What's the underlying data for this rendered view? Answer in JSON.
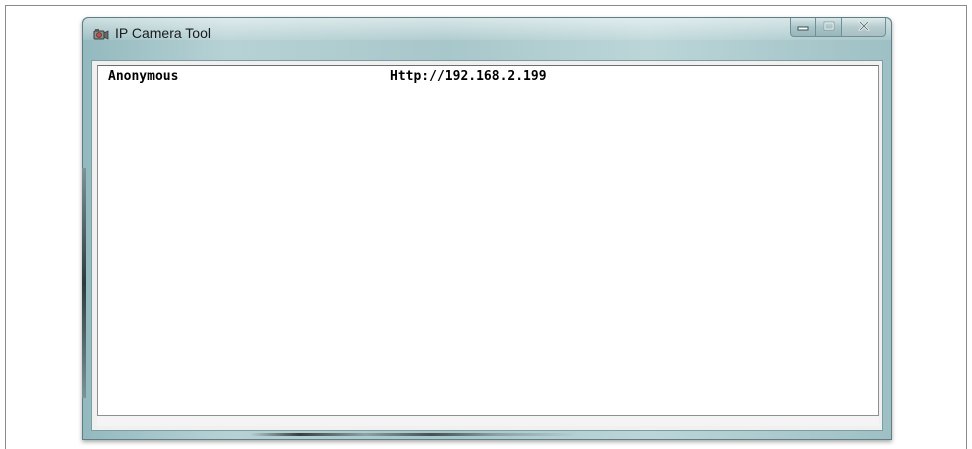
{
  "window": {
    "title": "IP Camera Tool",
    "icon": "camera-icon",
    "controls": {
      "minimize_icon": "minimize-icon",
      "maximize_icon": "maximize-icon",
      "close_icon": "close-icon"
    }
  },
  "camera_list": {
    "rows": [
      {
        "name": "Anonymous",
        "url": "Http://192.168.2.199"
      }
    ]
  },
  "colors": {
    "title_bar": "#a8c7ca",
    "list_background": "#ffffff",
    "text": "#000000"
  }
}
